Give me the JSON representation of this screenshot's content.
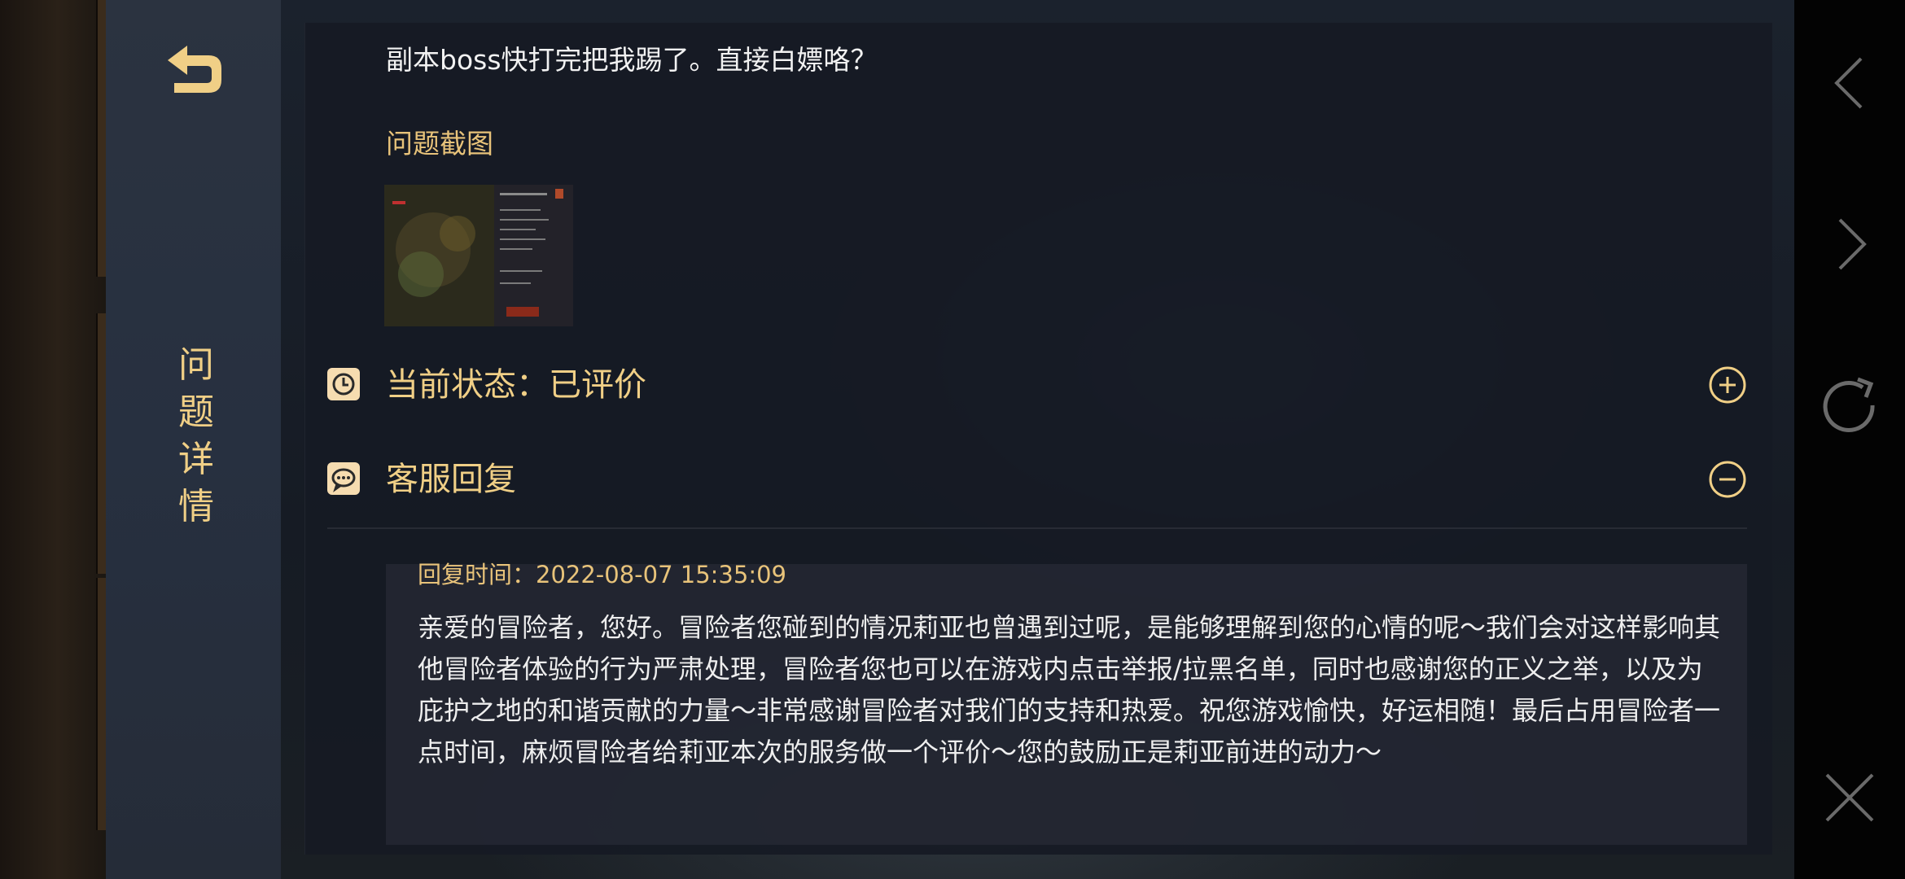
{
  "sidebar": {
    "title_chars": [
      "问",
      "题",
      "详",
      "情"
    ]
  },
  "question": {
    "description": "副本boss快打完把我踢了。直接白嫖咯？",
    "screenshot_label": "问题截图"
  },
  "status": {
    "text": "当前状态：已评价"
  },
  "reply_section": {
    "title": "客服回复",
    "time": "回复时间：2022-08-07 15:35:09",
    "body": "亲爱的冒险者，您好。冒险者您碰到的情况莉亚也曾遇到过呢，是能够理解到您的心情的呢～我们会对这样影响其他冒险者体验的行为严肃处理，冒险者您也可以在游戏内点击举报/拉黑名单，同时也感谢您的正义之举，以及为庇护之地的和谐贡献的力量～非常感谢冒险者对我们的支持和热爱。祝您游戏愉快，好运相随！最后占用冒险者一点时间，麻烦冒险者给莉亚本次的服务做一个评价～您的鼓励正是莉亚前进的动力～"
  },
  "icons": {
    "back": "undo-arrow-icon",
    "status": "clock-icon",
    "reply": "chat-bubble-icon",
    "expand": "plus-circle-icon",
    "collapse": "minus-circle-icon",
    "nav": [
      "chevron-left-icon",
      "chevron-right-icon",
      "refresh-icon",
      "close-icon"
    ]
  },
  "colors": {
    "accent": "#f0cf86",
    "label": "#e8c37a",
    "panel": "#161a24",
    "sidebar": "#273040"
  }
}
